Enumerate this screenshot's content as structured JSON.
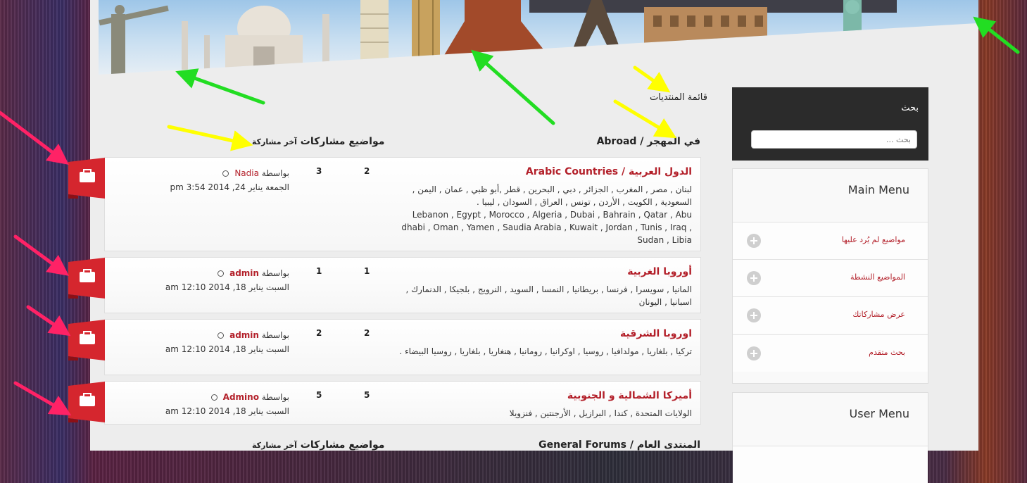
{
  "breadcrumb": {
    "title": "قائمة المنتديات"
  },
  "category": {
    "title": "في المهجر / Abroad",
    "columns": {
      "topics_posts": "مواضيع مشاركات",
      "last_post": "آخر مشاركة"
    }
  },
  "forums": [
    {
      "title": "الدول العربية / Arabic Countries",
      "desc": "لبنان , مصر , المغرب , الجزائر , دبي , البحرين , قطر ,أبو ظبي , عمان , اليمن , السعودية , الكويت , الأردن , تونس , العراق , السودان , ليبيا .",
      "desc_en": "Lebanon , Egypt , Morocco , Algeria , Dubai , Bahrain , Qatar , Abu dhabi , Oman , Yamen , Saudia Arabia , Kuwait , Jordan , Tunis , Iraq , Sudan , Libia",
      "topics": "2",
      "posts": "3",
      "by": "بواسطة",
      "author": "Nadia",
      "date": "الجمعة يناير 24, 2014 3:54 pm"
    },
    {
      "title": "أوروبا الغربية",
      "desc": "المانيا , سويسرا , فرنسا , بريطانيا , النمسا , السويد , النرويج , بلجيكا , الدنمارك , اسبانيا , اليونان",
      "topics": "1",
      "posts": "1",
      "by": "بواسطة",
      "author": "admin",
      "date": "السبت يناير 18, 2014 12:10 am"
    },
    {
      "title": "اوروبا الشرقية",
      "desc": "تركيا , بلغاريا , مولدافيا , روسيا , اوكرانيا , رومانيا , هنغاريا , بلغاريا , روسيا البيضاء .",
      "topics": "2",
      "posts": "2",
      "by": "بواسطة",
      "author": "admin",
      "date": "السبت يناير 18, 2014 12:10 am"
    },
    {
      "title": "أميركا الشمالية و الجنوبية",
      "desc": "الولايات المتحدة , كندا , البرازيل , الأرجنتين , فنزويلا",
      "topics": "5",
      "posts": "5",
      "by": "بواسطة",
      "author": "Admino",
      "date": "السبت يناير 18, 2014 12:10 am"
    }
  ],
  "category2": {
    "title": "المنتدى العام / General Forums",
    "columns": {
      "topics_posts": "مواضيع مشاركات",
      "last_post": "آخر مشاركة"
    }
  },
  "sidebar": {
    "search": {
      "title": "بحث",
      "placeholder": "بحث ..."
    },
    "main_menu": {
      "title": "Main Menu",
      "items": [
        {
          "label": "مواضيع لم يُرد عليها"
        },
        {
          "label": "المواضيع النشطة"
        },
        {
          "label": "عرض مشاركاتك"
        },
        {
          "label": "بحث متقدم"
        }
      ]
    },
    "user_menu": {
      "title": "User Menu"
    }
  },
  "colors": {
    "accent": "#b3202a",
    "sidebar_dark": "#2b2b2b",
    "annotation_green": "#22dd22",
    "annotation_yellow": "#ffff00",
    "annotation_pink": "#ff2266"
  }
}
